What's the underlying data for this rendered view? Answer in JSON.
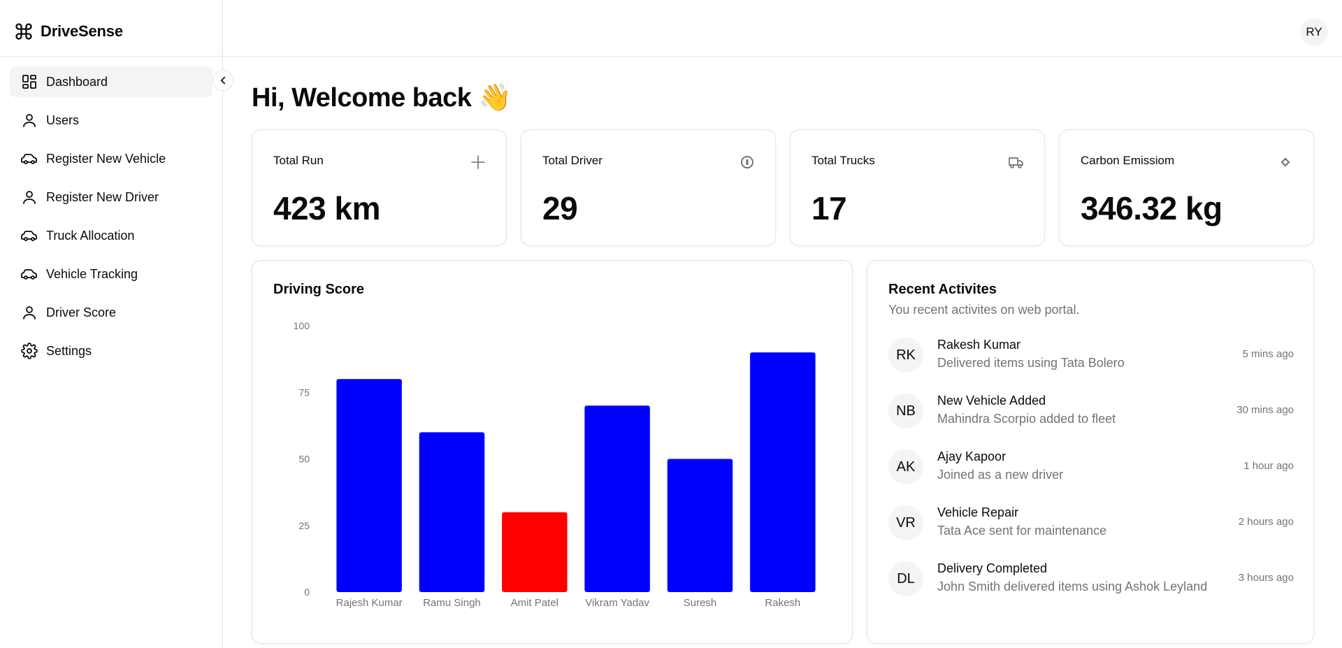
{
  "app": {
    "name": "DriveSense",
    "user_initials": "RY"
  },
  "sidebar": {
    "items": [
      {
        "label": "Dashboard",
        "icon": "dashboard-icon",
        "active": true
      },
      {
        "label": "Users",
        "icon": "user-icon"
      },
      {
        "label": "Register New Vehicle",
        "icon": "car-icon"
      },
      {
        "label": "Register New Driver",
        "icon": "user-icon"
      },
      {
        "label": "Truck Allocation",
        "icon": "car-icon"
      },
      {
        "label": "Vehicle Tracking",
        "icon": "car-icon"
      },
      {
        "label": "Driver Score",
        "icon": "user-icon"
      },
      {
        "label": "Settings",
        "icon": "gear-icon"
      }
    ]
  },
  "main": {
    "greeting": "Hi, Welcome back 👋",
    "stats": [
      {
        "title": "Total Run",
        "value": "423 km",
        "icon": "plus-icon"
      },
      {
        "title": "Total Driver",
        "value": "29",
        "icon": "info-circle-icon"
      },
      {
        "title": "Total Trucks",
        "value": "17",
        "icon": "truck-icon"
      },
      {
        "title": "Carbon Emissiom",
        "value": "346.32 kg",
        "icon": "diamond-icon"
      }
    ],
    "driving_score": {
      "title": "Driving Score"
    },
    "recent": {
      "title": "Recent Activites",
      "subtitle": "You recent activites on web portal.",
      "items": [
        {
          "initials": "RK",
          "name": "Rakesh Kumar",
          "desc": "Delivered items using Tata Bolero",
          "time": "5 mins ago"
        },
        {
          "initials": "NB",
          "name": "New Vehicle Added",
          "desc": "Mahindra Scorpio added to fleet",
          "time": "30 mins ago"
        },
        {
          "initials": "AK",
          "name": "Ajay Kapoor",
          "desc": "Joined as a new driver",
          "time": "1 hour ago"
        },
        {
          "initials": "VR",
          "name": "Vehicle Repair",
          "desc": "Tata Ace sent for maintenance",
          "time": "2 hours ago"
        },
        {
          "initials": "DL",
          "name": "Delivery Completed",
          "desc": "John Smith delivered items using Ashok Leyland",
          "time": "3 hours ago"
        }
      ]
    }
  },
  "colors": {
    "bar_default": "#0000ff",
    "bar_low": "#ff0000",
    "muted": "#737373"
  },
  "chart_data": {
    "type": "bar",
    "title": "Driving Score",
    "categories": [
      "Rajesh Kumar",
      "Ramu Singh",
      "Amit Patel",
      "Vikram Yadav",
      "Suresh",
      "Rakesh"
    ],
    "values": [
      80,
      60,
      30,
      70,
      50,
      90
    ],
    "bar_colors": [
      "#0000ff",
      "#0000ff",
      "#ff0000",
      "#0000ff",
      "#0000ff",
      "#0000ff"
    ],
    "ylim": [
      0,
      100
    ],
    "yticks": [
      "0",
      "25",
      "50",
      "75",
      "100"
    ],
    "grid": false,
    "legend": "none"
  }
}
